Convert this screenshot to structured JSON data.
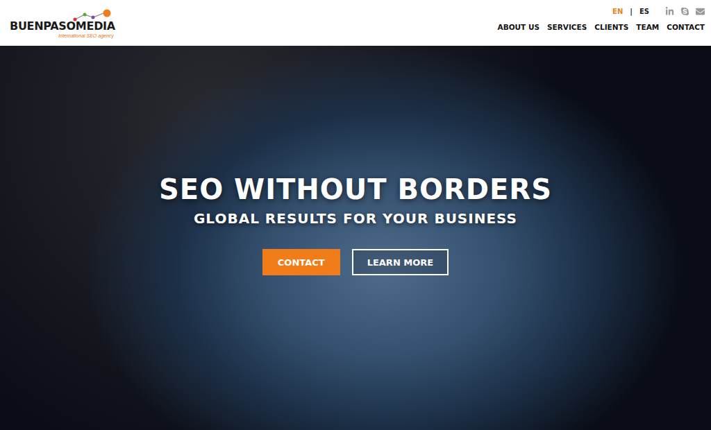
{
  "header": {
    "logo": {
      "name": "BUENPASOMEDIA",
      "tagline": "International SEO agency"
    },
    "languages": [
      {
        "label": "EN",
        "selected": true
      },
      {
        "label": "ES",
        "selected": false
      }
    ],
    "separator": "|",
    "nav": [
      "ABOUT US",
      "SERVICES",
      "CLIENTS",
      "TEAM",
      "CONTACT"
    ]
  },
  "hero": {
    "title": "SEO WITHOUT BORDERS",
    "subtitle": "GLOBAL RESULTS FOR YOUR BUSINESS",
    "buttons": [
      {
        "label": "CONTACT",
        "kind": "primary"
      },
      {
        "label": "LEARN MORE",
        "kind": "outline"
      }
    ]
  }
}
